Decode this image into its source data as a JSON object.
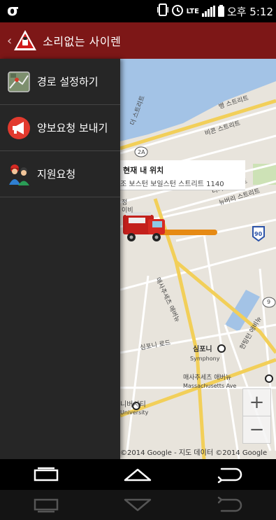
{
  "status_bar": {
    "carrier_glyph": "σ",
    "network": "LTE",
    "time": "오후 5:12",
    "icons": [
      "vibrate-icon",
      "alarm-icon",
      "lte-icon",
      "signal-icon",
      "battery-icon"
    ]
  },
  "action_bar": {
    "back_glyph": "‹",
    "title": "소리없는 사이렌",
    "logo_icon": "siren-warning-icon",
    "bg_color": "#7d1717"
  },
  "drawer": {
    "items": [
      {
        "label": "경로 설정하기",
        "icon": "map-route-icon"
      },
      {
        "label": "양보요청 보내기",
        "icon": "megaphone-icon"
      },
      {
        "label": "지원요청",
        "icon": "rescuers-icon"
      }
    ]
  },
  "map": {
    "callout_title": "현재 내 위치",
    "callout_address": "조 보스턴 보일스턴 스트리트 1140",
    "labels": {
      "street1": "뱅 스트리트",
      "street2": "비콘 스트리트",
      "street3": "더 스트리트",
      "street4": "뉴버리 스트리트",
      "street5": "터리 스트리트",
      "road_2a": "2A",
      "road_90": "90",
      "road_9": "9",
      "mass_ave": "매사추세츠 애버뉴",
      "mass_ave_en": "Massachusetts Ave",
      "symphony_rd": "심포니 로드",
      "symphony": "심포니",
      "symphony_en": "Symphony",
      "huntington": "헌팅턴 애비뉴",
      "university": "니버시티",
      "university_en": "University",
      "jung": "정",
      "e_soft": "이비"
    },
    "zoom_in": "+",
    "zoom_out": "−",
    "copyright": "©2014 Google - 지도 데이터 ©2014 Google"
  },
  "nav_bar": {
    "buttons": [
      "recent-apps",
      "home",
      "back"
    ]
  }
}
